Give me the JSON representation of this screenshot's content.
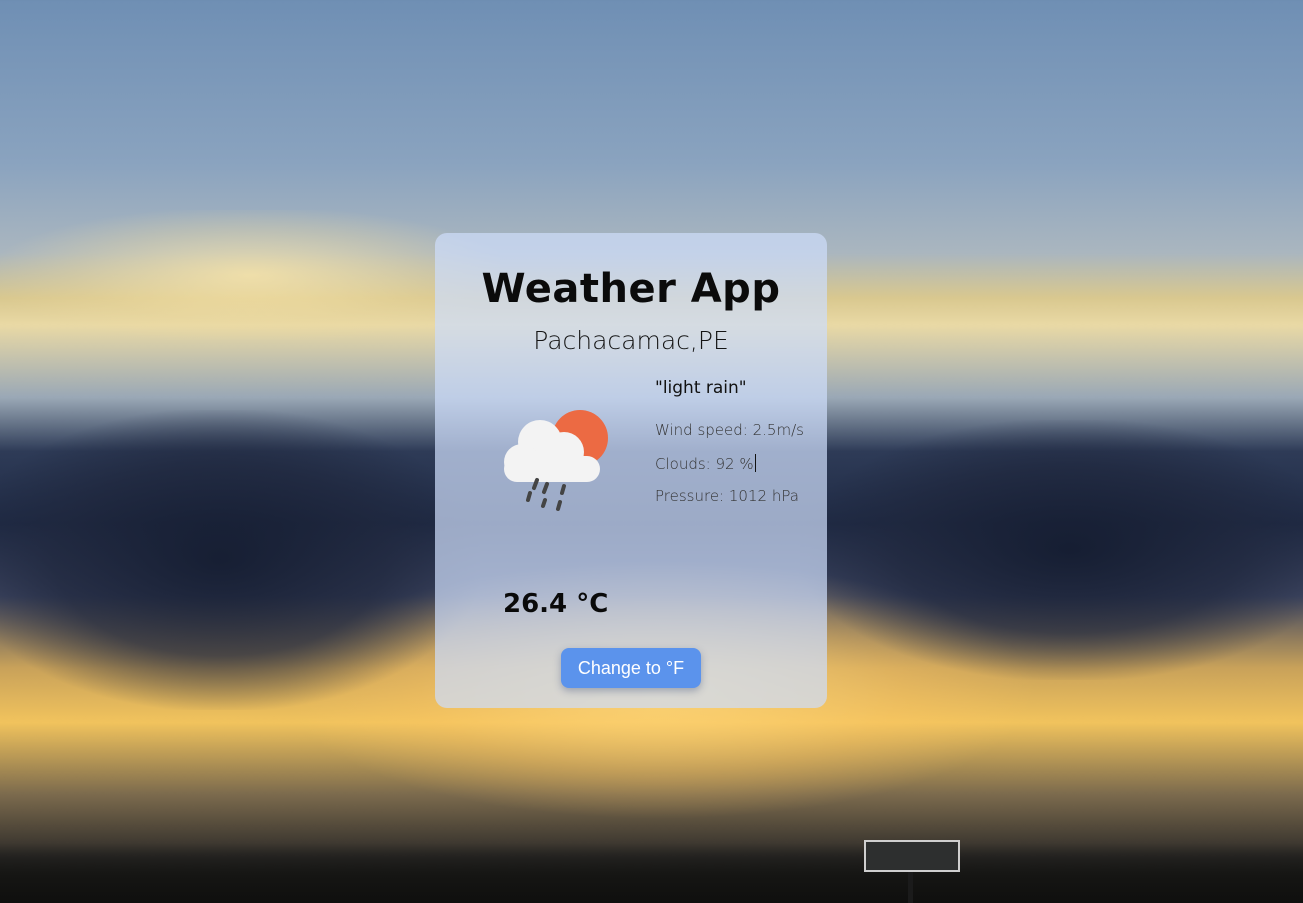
{
  "app": {
    "title": "Weather App",
    "location": "Pachacamac,PE"
  },
  "weather": {
    "description": "\"light rain\"",
    "wind_speed": "Wind speed: 2.5m/s",
    "clouds": "Clouds: 92 %",
    "pressure": "Pressure: 1012 hPa",
    "temperature": "26.4 °C",
    "icon": "cloud-sun-rain-icon"
  },
  "controls": {
    "change_unit_label": "Change to °F"
  },
  "colors": {
    "accent_button": "#5b93ec",
    "sun": "#ec6a43",
    "card": "rgba(205, 220, 250, 0.72)"
  }
}
